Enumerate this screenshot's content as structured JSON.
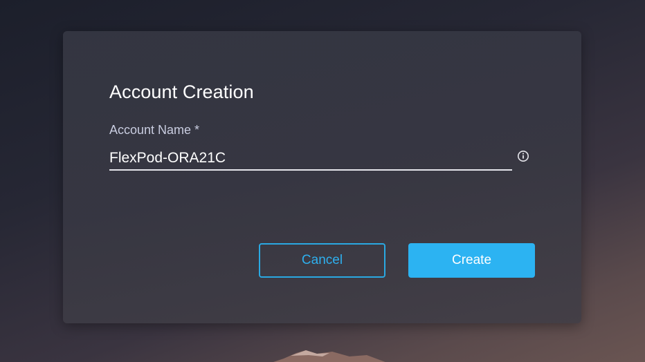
{
  "dialog": {
    "title": "Account Creation",
    "account_name": {
      "label": "Account Name *",
      "value": "FlexPod-ORA21C"
    },
    "buttons": {
      "cancel_label": "Cancel",
      "create_label": "Create"
    }
  },
  "icons": {
    "field_info": "info-circle-icon"
  },
  "colors": {
    "accent": "#2cb3f2",
    "dialog_background": "#363744",
    "text_primary": "#ffffff",
    "label_text": "#c9cde0"
  }
}
